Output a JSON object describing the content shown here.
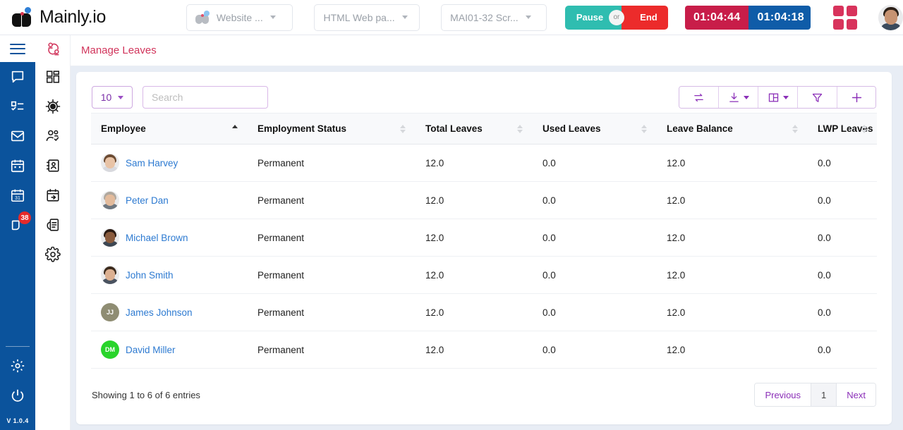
{
  "brand": {
    "name": "Mainly.io",
    "logo_icon": "book-logo-icon"
  },
  "topbar": {
    "selects": [
      {
        "name": "website-select",
        "label": "Website ...",
        "icon": "leaf-logo-icon"
      },
      {
        "name": "project-select",
        "label": "HTML Web pa..."
      },
      {
        "name": "task-select",
        "label": "MAI01-32 Scr..."
      }
    ],
    "pause_label": "Pause",
    "or_label": "or",
    "end_label": "End",
    "timer_red": "01:04:44",
    "timer_blue": "01:04:18",
    "grid_icon": "apps-grid-icon",
    "avatar_icon": "user-avatar",
    "colors": {
      "pause": "#2fbdb0",
      "end": "#ec2b2b",
      "timer_red": "#c81d49",
      "timer_blue": "#0f5ca8",
      "grid": "#d8335c"
    }
  },
  "sidebar": {
    "menu_icon": "hamburger-menu-icon",
    "version": "V 1.0.4",
    "blue_rail_color": "#0b539c",
    "blue_items": [
      {
        "icon": "chat-bubble-icon",
        "badge": null
      },
      {
        "icon": "task-list-icon",
        "badge": null
      },
      {
        "icon": "mail-envelope-icon",
        "badge": null
      },
      {
        "icon": "calendar-icon",
        "badge": null
      },
      {
        "icon": "calendar-31-icon",
        "badge": null
      },
      {
        "icon": "notification-tag-icon",
        "badge": "38"
      }
    ],
    "blue_bottom": [
      {
        "icon": "settings-gear-icon"
      },
      {
        "icon": "power-off-icon"
      }
    ],
    "white_items": [
      {
        "icon": "people-network-icon",
        "active": true
      },
      {
        "icon": "dashboard-grid-icon",
        "active": false
      },
      {
        "icon": "gear-sun-icon",
        "active": false
      },
      {
        "icon": "users-check-icon",
        "active": false
      },
      {
        "icon": "contact-card-icon",
        "active": false
      },
      {
        "icon": "calendar-send-icon",
        "active": false
      },
      {
        "icon": "clipboard-icon",
        "active": false
      },
      {
        "icon": "settings-cog-icon",
        "active": false
      }
    ]
  },
  "page": {
    "title": "Manage Leaves",
    "title_color": "#d1345b"
  },
  "toolbar": {
    "page_length": "10",
    "search_placeholder": "Search",
    "search_value": "",
    "buttons": [
      {
        "name": "refresh-button",
        "icon": "swap-arrows-icon",
        "caret": false
      },
      {
        "name": "export-button",
        "icon": "download-icon",
        "caret": true
      },
      {
        "name": "columns-button",
        "icon": "columns-layout-icon",
        "caret": true
      },
      {
        "name": "filter-button",
        "icon": "filter-funnel-icon",
        "caret": false
      },
      {
        "name": "add-button",
        "icon": "plus-icon",
        "caret": false
      }
    ]
  },
  "table": {
    "columns": [
      {
        "label": "Employee",
        "sort": "asc"
      },
      {
        "label": "Employment Status",
        "sort": "none"
      },
      {
        "label": "Total Leaves",
        "sort": "none"
      },
      {
        "label": "Used Leaves",
        "sort": "none"
      },
      {
        "label": "Leave Balance",
        "sort": "none"
      },
      {
        "label": "LWP Leaves",
        "sort": "none"
      }
    ],
    "rows": [
      {
        "name": "Sam Harvey",
        "avatar_type": "photo",
        "hair": "#6b4a31",
        "face": "#e8c3a6",
        "body": "#d8d9de",
        "status": "Permanent",
        "total": "12.0",
        "used": "0.0",
        "balance": "12.0",
        "lwp": "0.0"
      },
      {
        "name": "Peter Dan",
        "avatar_type": "photo",
        "hair": "#b0a89e",
        "face": "#e3bb9c",
        "body": "#6f7780",
        "status": "Permanent",
        "total": "12.0",
        "used": "0.0",
        "balance": "12.0",
        "lwp": "0.0"
      },
      {
        "name": "Michael Brown",
        "avatar_type": "photo",
        "hair": "#2a1a12",
        "face": "#8a5b3d",
        "body": "#3d4753",
        "status": "Permanent",
        "total": "12.0",
        "used": "0.0",
        "balance": "12.0",
        "lwp": "0.0"
      },
      {
        "name": "John Smith",
        "avatar_type": "photo",
        "hair": "#3b2a1c",
        "face": "#dcb091",
        "body": "#4a5360",
        "status": "Permanent",
        "total": "12.0",
        "used": "0.0",
        "balance": "12.0",
        "lwp": "0.0"
      },
      {
        "name": "James Johnson",
        "avatar_type": "initials",
        "initials": "JJ",
        "color": "#8f8d73",
        "status": "Permanent",
        "total": "12.0",
        "used": "0.0",
        "balance": "12.0",
        "lwp": "0.0"
      },
      {
        "name": "David Miller",
        "avatar_type": "initials",
        "initials": "DM",
        "color": "#29d42b",
        "status": "Permanent",
        "total": "12.0",
        "used": "0.0",
        "balance": "12.0",
        "lwp": "0.0"
      }
    ]
  },
  "footer": {
    "entries_text": "Showing 1 to 6 of 6 entries",
    "previous_label": "Previous",
    "page_label": "1",
    "next_label": "Next"
  }
}
